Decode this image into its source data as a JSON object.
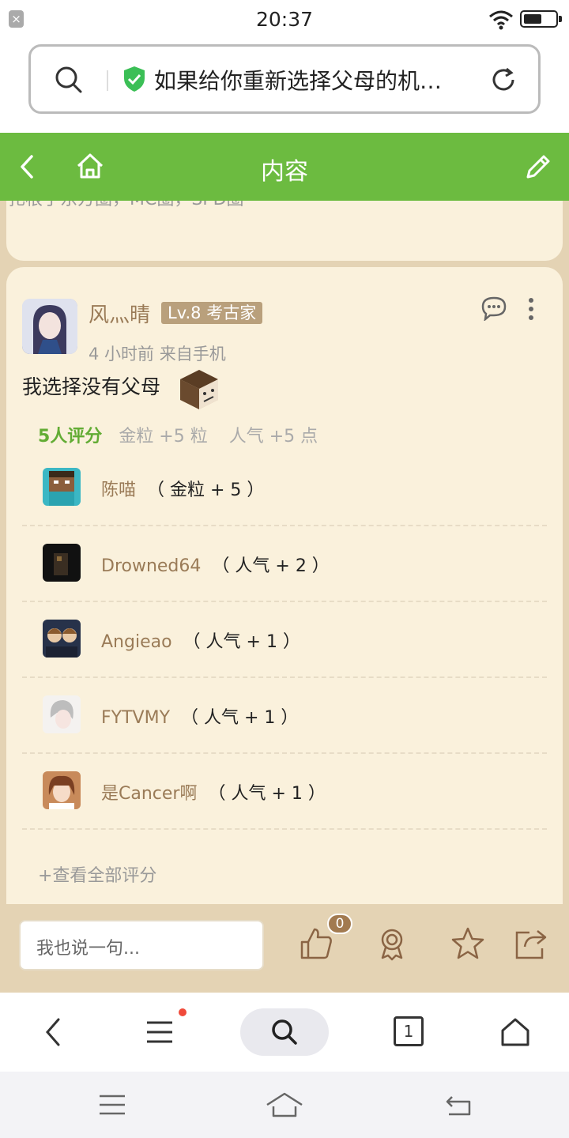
{
  "status": {
    "time": "20:37",
    "close_glyph": "×"
  },
  "address": {
    "url": "如果给你重新选择父母的机…"
  },
  "header": {
    "title": "内容"
  },
  "prev_card": {
    "text": "扎根于东方圈，MC圈，SPD圈"
  },
  "post": {
    "username": "风灬晴",
    "level": "Lv.8 考古家",
    "meta": "4 小时前 来自手机",
    "text": "我选择没有父母",
    "rating_count": "5人评分",
    "gold": "金粒 +5 粒",
    "popularity": "人气 +5 点",
    "raters": [
      {
        "name": "陈喵",
        "points": "（ 金粒 + 5 ）"
      },
      {
        "name": "Drowned64",
        "points": "（ 人气 + 2 ）"
      },
      {
        "name": "Angieao",
        "points": "（ 人气 + 1 ）"
      },
      {
        "name": "FYTVMY",
        "points": "（ 人气 + 1 ）"
      },
      {
        "name": "是Cancer啊",
        "points": "（ 人气 + 1 ）"
      }
    ],
    "view_all": "+查看全部评分"
  },
  "comment_bar": {
    "placeholder": "我也说一句...",
    "like_count": "0"
  },
  "bottom_nav": {
    "tabs_count": "1"
  },
  "colors": {
    "green": "#6cbb40",
    "brown": "#9a7b57",
    "card": "#faf1dc"
  },
  "icons": [
    "search-icon",
    "shield-icon",
    "refresh-icon",
    "back-icon",
    "home-icon",
    "edit-icon",
    "comment-icon",
    "more-icon",
    "thumbs-up-icon",
    "award-icon",
    "star-icon",
    "share-icon",
    "menu-icon",
    "tabs-icon"
  ]
}
